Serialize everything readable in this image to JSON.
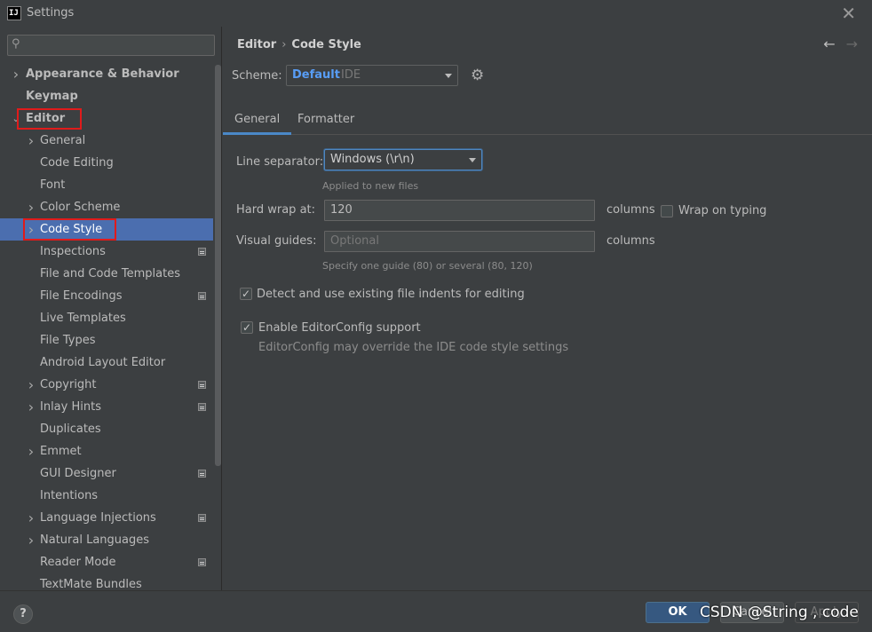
{
  "window": {
    "title": "Settings",
    "logo_text": "IJ"
  },
  "search": {
    "value": "",
    "placeholder": ""
  },
  "sidebar": {
    "items": [
      {
        "label": "Appearance & Behavior",
        "level": 0,
        "chevron": "right",
        "badge": false
      },
      {
        "label": "Keymap",
        "level": 0,
        "chevron": "none",
        "badge": false
      },
      {
        "label": "Editor",
        "level": 0,
        "chevron": "down",
        "badge": false
      },
      {
        "label": "General",
        "level": 1,
        "chevron": "right",
        "badge": false
      },
      {
        "label": "Code Editing",
        "level": 1,
        "chevron": "none",
        "badge": false
      },
      {
        "label": "Font",
        "level": 1,
        "chevron": "none",
        "badge": false
      },
      {
        "label": "Color Scheme",
        "level": 1,
        "chevron": "right",
        "badge": false
      },
      {
        "label": "Code Style",
        "level": 1,
        "chevron": "right",
        "badge": false,
        "selected": true
      },
      {
        "label": "Inspections",
        "level": 1,
        "chevron": "none",
        "badge": true
      },
      {
        "label": "File and Code Templates",
        "level": 1,
        "chevron": "none",
        "badge": false
      },
      {
        "label": "File Encodings",
        "level": 1,
        "chevron": "none",
        "badge": true
      },
      {
        "label": "Live Templates",
        "level": 1,
        "chevron": "none",
        "badge": false
      },
      {
        "label": "File Types",
        "level": 1,
        "chevron": "none",
        "badge": false
      },
      {
        "label": "Android Layout Editor",
        "level": 1,
        "chevron": "none",
        "badge": false
      },
      {
        "label": "Copyright",
        "level": 1,
        "chevron": "right",
        "badge": true
      },
      {
        "label": "Inlay Hints",
        "level": 1,
        "chevron": "right",
        "badge": true
      },
      {
        "label": "Duplicates",
        "level": 1,
        "chevron": "none",
        "badge": false
      },
      {
        "label": "Emmet",
        "level": 1,
        "chevron": "right",
        "badge": false
      },
      {
        "label": "GUI Designer",
        "level": 1,
        "chevron": "none",
        "badge": true
      },
      {
        "label": "Intentions",
        "level": 1,
        "chevron": "none",
        "badge": false
      },
      {
        "label": "Language Injections",
        "level": 1,
        "chevron": "right",
        "badge": true
      },
      {
        "label": "Natural Languages",
        "level": 1,
        "chevron": "right",
        "badge": false
      },
      {
        "label": "Reader Mode",
        "level": 1,
        "chevron": "none",
        "badge": true
      },
      {
        "label": "TextMate Bundles",
        "level": 1,
        "chevron": "none",
        "badge": false
      }
    ]
  },
  "main": {
    "breadcrumb": [
      "Editor",
      "Code Style"
    ],
    "scheme": {
      "label": "Scheme:",
      "name": "Default",
      "type": "IDE"
    },
    "tabs": [
      {
        "label": "General",
        "active": true
      },
      {
        "label": "Formatter",
        "active": false
      }
    ],
    "line_separator": {
      "label": "Line separator:",
      "value": "Windows (\\r\\n)",
      "hint": "Applied to new files"
    },
    "hard_wrap": {
      "label": "Hard wrap at:",
      "value": "120",
      "unit": "columns"
    },
    "wrap_on_typing": {
      "label": "Wrap on typing",
      "checked": false
    },
    "visual_guides": {
      "label": "Visual guides:",
      "value": "",
      "placeholder": "Optional",
      "unit": "columns",
      "hint": "Specify one guide (80) or several (80, 120)"
    },
    "detect_indents": {
      "label": "Detect and use existing file indents for editing",
      "checked": true
    },
    "editorconfig": {
      "label": "Enable EditorConfig support",
      "checked": true,
      "hint": "EditorConfig may override the IDE code style settings"
    }
  },
  "footer": {
    "help": "?",
    "ok": "OK",
    "cancel": "Cancel",
    "apply": "Apply"
  },
  "watermark": "CSDN @String , code",
  "colors": {
    "accent": "#4b6eaf",
    "link": "#589df6",
    "highlight": "#e01b1b"
  }
}
